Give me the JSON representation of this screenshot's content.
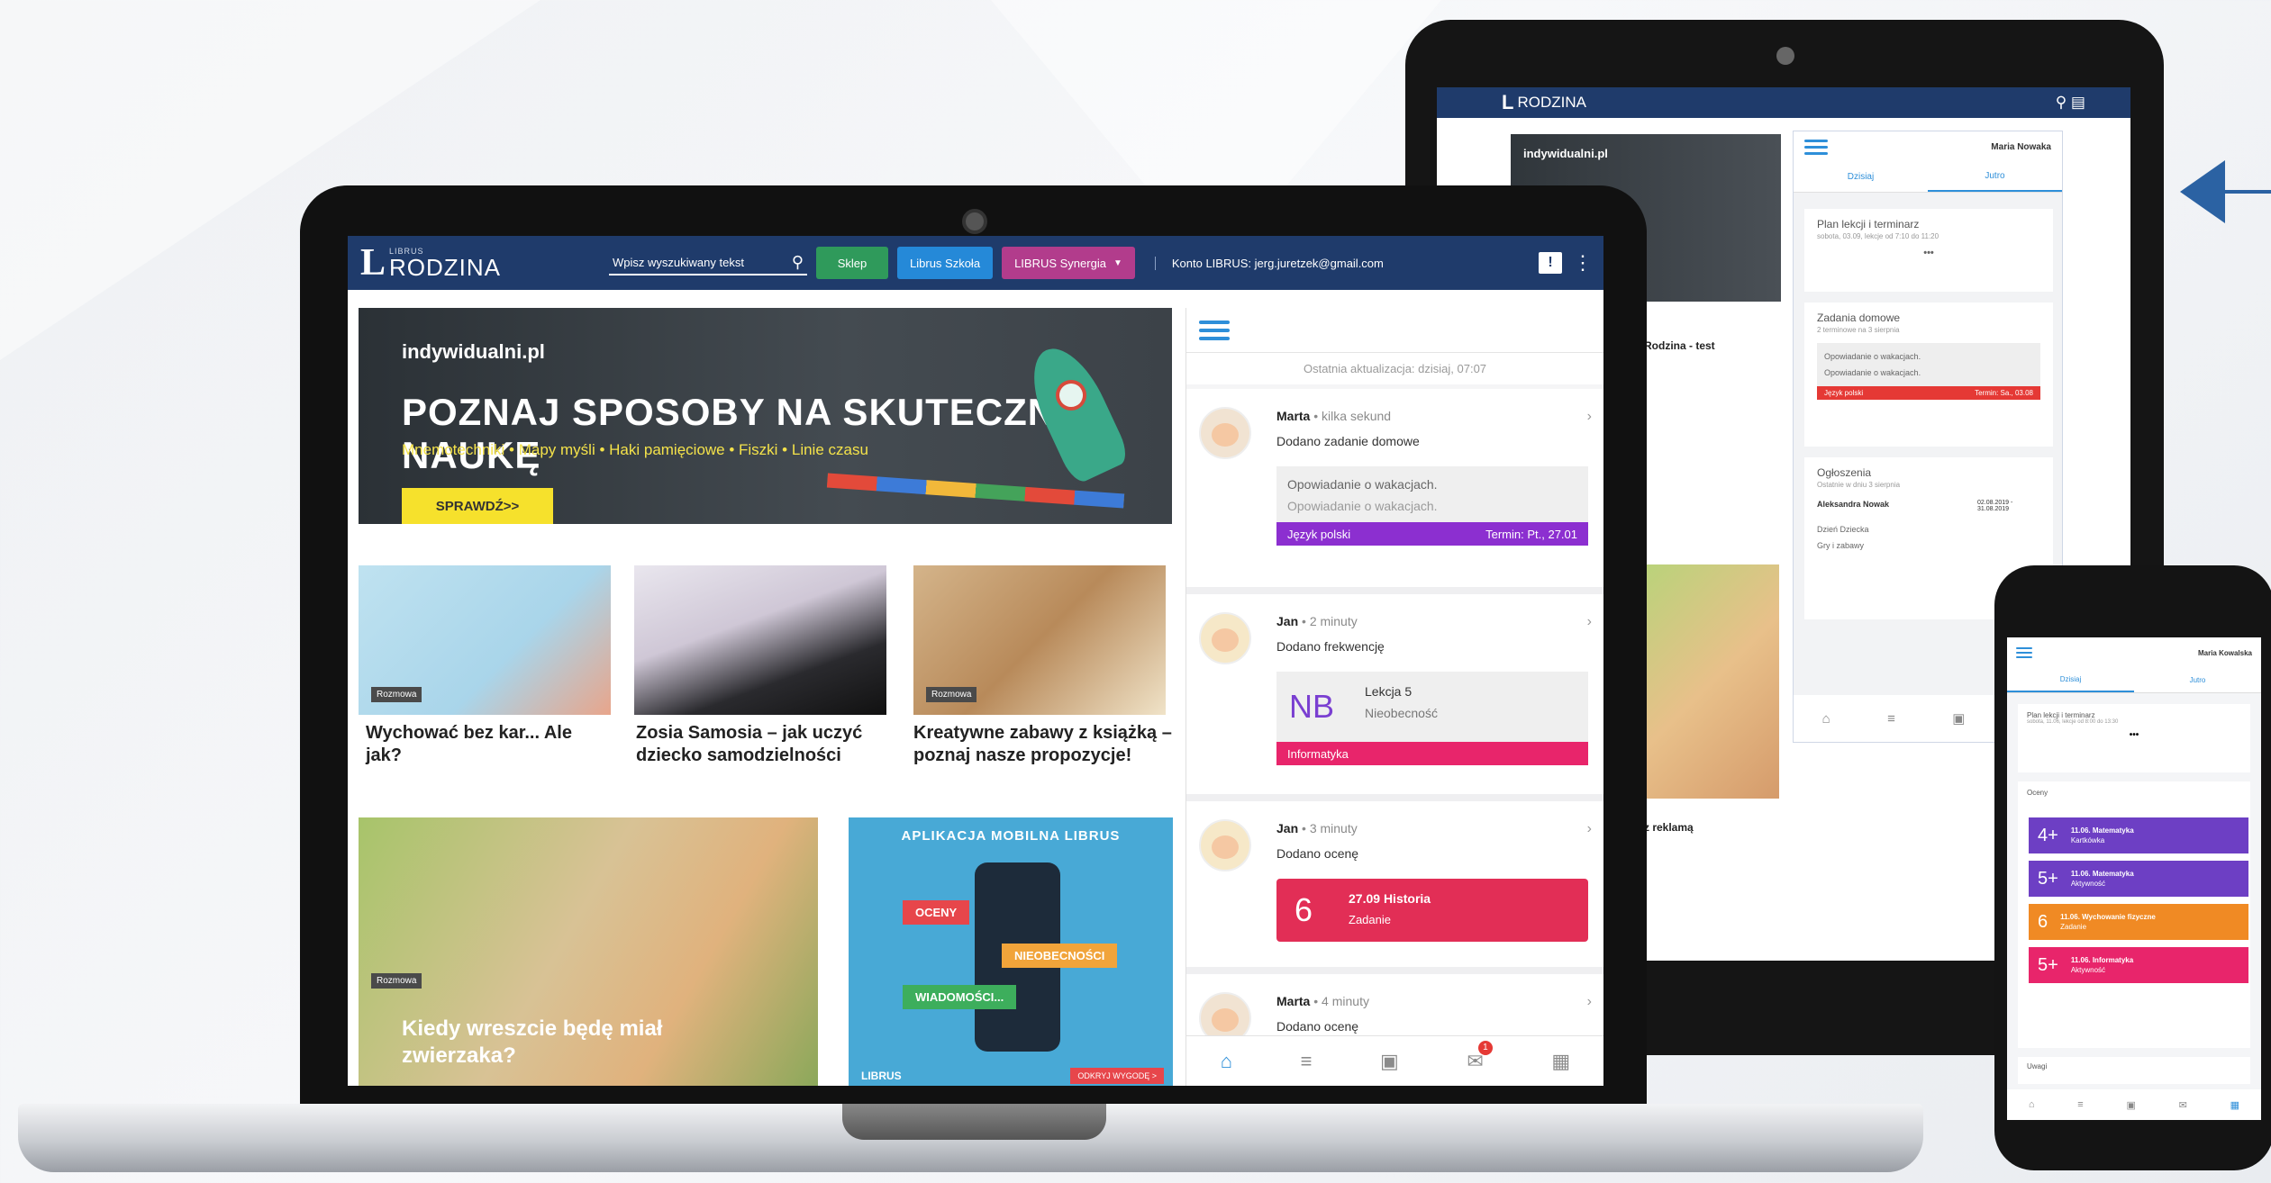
{
  "laptop": {
    "logo": {
      "small": "LIBRUS",
      "big": "RODZINA"
    },
    "search_placeholder": "Wpisz wyszukiwany tekst",
    "buttons": {
      "shop": "Sklep",
      "school": "Librus Szkoła",
      "synergia": "LIBRUS Synergia"
    },
    "account": "Konto LIBRUS: jerg.juretzek@gmail.com",
    "banner": {
      "brand": "indywidualni.pl",
      "headline": "POZNAJ SPOSOBY NA SKUTECZNĄ NAUKĘ",
      "tags": "Mnemotechniki  •  Mapy myśli  •  Haki pamięciowe  •  Fiszki  •  Linie czasu",
      "cta": "SPRAWDŹ>>"
    },
    "articles": [
      {
        "tag": "Rozmowa",
        "title": "Wychować bez kar... Ale jak?"
      },
      {
        "tag": "",
        "title": "Zosia Samosia – jak uczyć dziecko samodzielności"
      },
      {
        "tag": "Rozmowa",
        "title": "Kreatywne zabawy z książką – poznaj nasze propozycje!"
      },
      {
        "tag": "Rozmowa",
        "title": "Kiedy wreszcie będę miał zwierzaka?"
      },
      {
        "tag": "",
        "title": "APLIKACJA MOBILNA LIBRUS"
      }
    ],
    "app_promo": {
      "labels": [
        "OCENY",
        "NIEOBECNOŚCI",
        "WIADOMOŚCI..."
      ],
      "footer_logo": "LIBRUS",
      "footer_btn": "ODKRYJ WYGODĘ >"
    },
    "feed": {
      "updated": "Ostatnia aktualizacja: dzisiaj, 07:07",
      "items": [
        {
          "name": "Marta",
          "time": "kilka sekund",
          "action": "Dodano zadanie domowe",
          "lines": [
            "Opowiadanie o wakacjach.",
            "Opowiadanie o wakacjach."
          ],
          "subject": "Język polski",
          "due": "Termin: Pt., 27.01"
        },
        {
          "name": "Jan",
          "time": "2 minuty",
          "action": "Dodano frekwencję",
          "code": "NB",
          "lesson": "Lekcja 5",
          "status": "Nieobecność",
          "subject": "Informatyka"
        },
        {
          "name": "Jan",
          "time": "3 minuty",
          "action": "Dodano ocenę",
          "grade": "6",
          "date": "27.09",
          "grade_subject": "Historia",
          "kind": "Zadanie"
        },
        {
          "name": "Marta",
          "time": "4 minuty",
          "action": "Dodano ocenę"
        }
      ],
      "badge": "1"
    }
  },
  "tablet": {
    "logo": "RODZINA",
    "user": "Maria Nowaka",
    "tabs": [
      "Dzisiaj",
      "Jutro"
    ],
    "cards": [
      {
        "title": "Plan lekcji i terminarz",
        "sub": "sobota, 03.09, lekcje od 7:10 do 11:20"
      },
      {
        "title": "Zadania domowe",
        "sub": "2 terminowe na 3 sierpnia",
        "rows": [
          "Opowiadanie o wakacjach.",
          "Opowiadanie o wakacjach."
        ],
        "subject": "Język polski",
        "due": "Termin: Sa., 03.08"
      },
      {
        "title": "Ogłoszenia",
        "sub": "Ostatnie w dniu 3 sierpnia",
        "author": "Aleksandra Nowak",
        "dates": "02.08.2019 - 31.08.2019",
        "items": [
          "Dzień Dziecka",
          "Gry i zabawy"
        ]
      }
    ],
    "side_texts": [
      "Rodzina - test",
      "z reklamą"
    ]
  },
  "phone": {
    "user": "Maria Kowalska",
    "tabs": [
      "Dzisiaj",
      "Jutro"
    ],
    "plan": {
      "title": "Plan lekcji i terminarz",
      "sub": "sobota, 11.06, lekcje od 8:00 do 13:30"
    },
    "grades_title": "Oceny",
    "grades": [
      {
        "value": "4+",
        "label": "11.06. Matematyka",
        "sub": "Kartkówka",
        "color": "#6d3fc4"
      },
      {
        "value": "5+",
        "label": "11.06. Matematyka",
        "sub": "Aktywność",
        "color": "#6d3fc4"
      },
      {
        "value": "6",
        "label": "11.06. Wychowanie fizyczne",
        "sub": "Zadanie",
        "color": "#f08a24"
      },
      {
        "value": "5+",
        "label": "11.06. Informatyka",
        "sub": "Aktywność",
        "color": "#e8256b"
      }
    ],
    "footer_title": "Uwagi"
  },
  "colors": {
    "header": "#1f3b6b",
    "shop": "#2f9a5b",
    "school": "#2589d8",
    "synergia": "#b23c8c",
    "homework": "#8c2fd0",
    "it": "#e8256b",
    "grade": "#e22e56"
  }
}
